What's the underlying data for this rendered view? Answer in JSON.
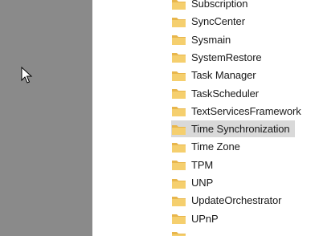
{
  "tree": {
    "items": [
      {
        "label": "Subscription",
        "icon": "folder-icon",
        "selected": false,
        "partial": true
      },
      {
        "label": "SyncCenter",
        "icon": "folder-icon",
        "selected": false
      },
      {
        "label": "Sysmain",
        "icon": "folder-icon",
        "selected": false
      },
      {
        "label": "SystemRestore",
        "icon": "folder-icon",
        "selected": false
      },
      {
        "label": "Task Manager",
        "icon": "folder-icon",
        "selected": false
      },
      {
        "label": "TaskScheduler",
        "icon": "folder-icon",
        "selected": false
      },
      {
        "label": "TextServicesFramework",
        "icon": "folder-icon",
        "selected": false
      },
      {
        "label": "Time Synchronization",
        "icon": "folder-icon",
        "selected": true
      },
      {
        "label": "Time Zone",
        "icon": "folder-icon",
        "selected": false
      },
      {
        "label": "TPM",
        "icon": "folder-icon",
        "selected": false
      },
      {
        "label": "UNP",
        "icon": "folder-icon",
        "selected": false
      },
      {
        "label": "UpdateOrchestrator",
        "icon": "folder-icon",
        "selected": false
      },
      {
        "label": "UPnP",
        "icon": "folder-icon",
        "selected": false
      },
      {
        "label": "",
        "icon": "folder-icon",
        "selected": false,
        "partial": true
      }
    ]
  },
  "colors": {
    "left_pane": "#8a8a8a",
    "selection": "#d9d9d9",
    "folder_body": "#f5cf6e",
    "folder_back": "#e8b64c"
  },
  "pointer": {
    "icon": "mouse-pointer-icon"
  }
}
